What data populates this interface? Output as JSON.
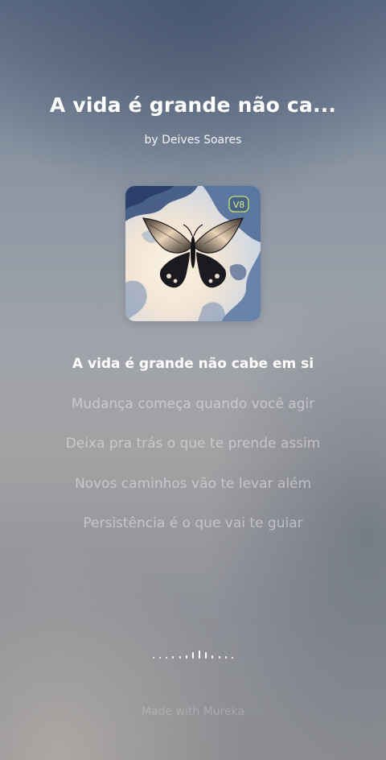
{
  "song": {
    "title": "A vida é grande não ca...",
    "artist": "by Deives Soares"
  },
  "cover": {
    "icon": "butterfly-album-art",
    "badge": "V8"
  },
  "lyrics": [
    "A vida é grande não cabe em si",
    "Mudança começa quando você agir",
    "Deixa pra trás o que te prende assim",
    "Novos caminhos vão te levar além",
    "Persistência é o que vai te guiar"
  ],
  "active_line_index": 0,
  "waveform": {
    "icon": "audio-waveform",
    "levels": [
      0.15,
      0.15,
      0.15,
      0.2,
      0.2,
      0.3,
      0.55,
      0.7,
      0.55,
      0.3,
      0.2,
      0.2,
      0.15
    ]
  },
  "footer": {
    "text": "Made with Mureka"
  },
  "colors": {
    "active_lyric": "#ffffff",
    "inactive_lyric": "#ebebee",
    "badge": "#c8e36b"
  }
}
